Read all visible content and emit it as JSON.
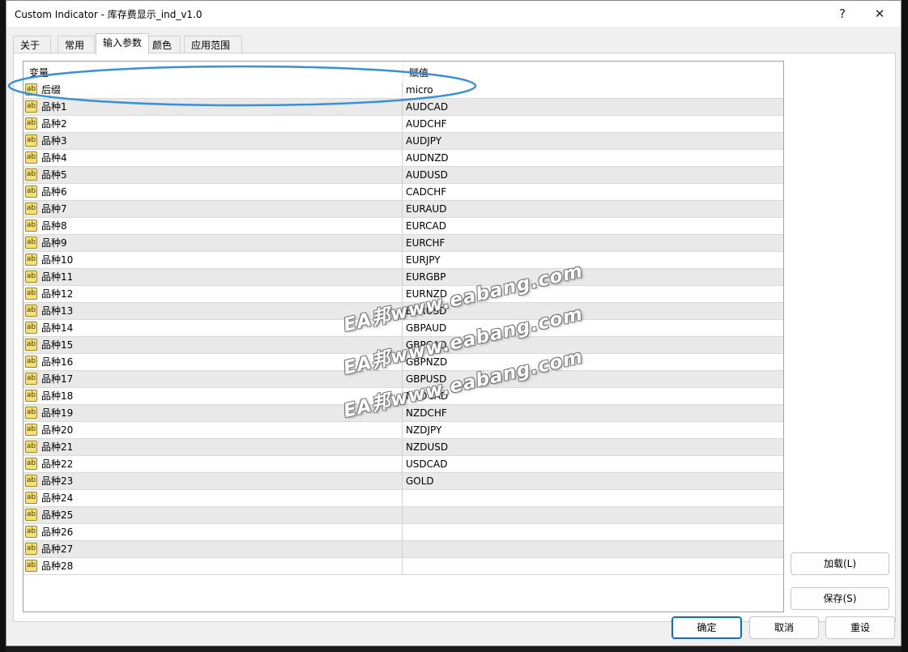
{
  "window": {
    "title": "Custom Indicator - 库存费显示_ind_v1.0",
    "help_label": "?",
    "close_label": "✕"
  },
  "tabs": [
    {
      "label": "关于"
    },
    {
      "label": "常用"
    },
    {
      "label": "输入参数",
      "active": true
    },
    {
      "label": "颜色"
    },
    {
      "label": "应用范围"
    }
  ],
  "grid": {
    "headers": {
      "variable": "变量",
      "value": "赋值"
    },
    "rows": [
      {
        "name": "后缀",
        "value": "micro"
      },
      {
        "name": "品种1",
        "value": "AUDCAD"
      },
      {
        "name": "品种2",
        "value": "AUDCHF"
      },
      {
        "name": "品种3",
        "value": "AUDJPY"
      },
      {
        "name": "品种4",
        "value": "AUDNZD"
      },
      {
        "name": "品种5",
        "value": "AUDUSD"
      },
      {
        "name": "品种6",
        "value": "CADCHF"
      },
      {
        "name": "品种7",
        "value": "EURAUD"
      },
      {
        "name": "品种8",
        "value": "EURCAD"
      },
      {
        "name": "品种9",
        "value": "EURCHF"
      },
      {
        "name": "品种10",
        "value": "EURJPY"
      },
      {
        "name": "品种11",
        "value": "EURGBP"
      },
      {
        "name": "品种12",
        "value": "EURNZD"
      },
      {
        "name": "品种13",
        "value": "EURUSD"
      },
      {
        "name": "品种14",
        "value": "GBPAUD"
      },
      {
        "name": "品种15",
        "value": "GBPCAD"
      },
      {
        "name": "品种16",
        "value": "GBPNZD"
      },
      {
        "name": "品种17",
        "value": "GBPUSD"
      },
      {
        "name": "品种18",
        "value": "NZDCAD"
      },
      {
        "name": "品种19",
        "value": "NZDCHF"
      },
      {
        "name": "品种20",
        "value": "NZDJPY"
      },
      {
        "name": "品种21",
        "value": "NZDUSD"
      },
      {
        "name": "品种22",
        "value": "USDCAD"
      },
      {
        "name": "品种23",
        "value": "GOLD"
      },
      {
        "name": "品种24",
        "value": ""
      },
      {
        "name": "品种25",
        "value": ""
      },
      {
        "name": "品种26",
        "value": ""
      },
      {
        "name": "品种27",
        "value": ""
      },
      {
        "name": "品种28",
        "value": ""
      }
    ],
    "type_icon": "ab"
  },
  "side_buttons": {
    "load": "加载(L)",
    "save": "保存(S)"
  },
  "bottom_buttons": {
    "ok": "确定",
    "cancel": "取消",
    "reset": "重设"
  },
  "watermark": "EA邦www.eabang.com",
  "highlight_color": "#3a8fd6"
}
